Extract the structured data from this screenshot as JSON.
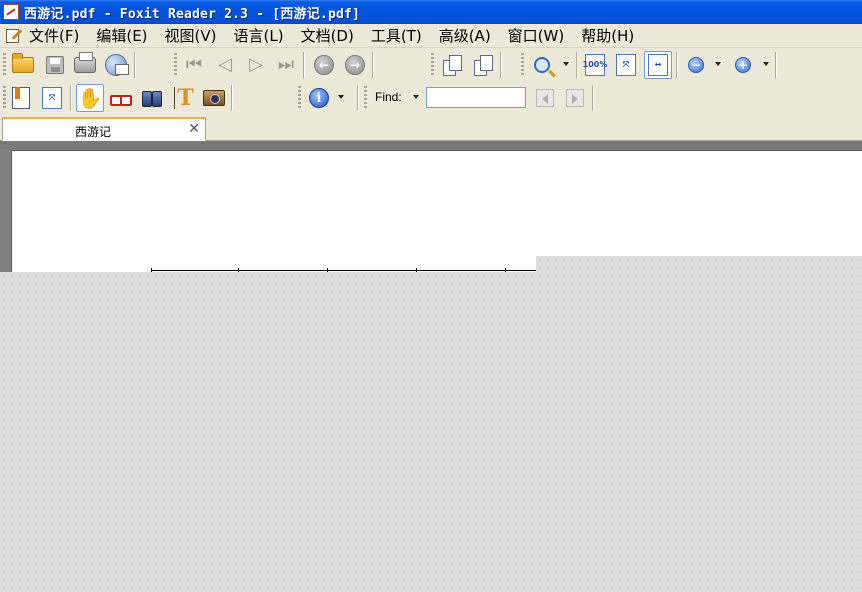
{
  "window": {
    "title": "西游记.pdf - Foxit Reader 2.3 - [西游记.pdf]"
  },
  "menubar": {
    "items": [
      "文件(F)",
      "编辑(E)",
      "视图(V)",
      "语言(L)",
      "文档(D)",
      "工具(T)",
      "高级(A)",
      "窗口(W)",
      "帮助(H)"
    ]
  },
  "toolbar1": {
    "icons": [
      "open-folder-icon",
      "save-icon",
      "print-icon",
      "email-icon",
      "first-page-icon",
      "previous-page-icon",
      "next-page-icon",
      "last-page-icon",
      "go-back-icon",
      "go-forward-icon",
      "rotate-left-icon",
      "rotate-right-icon",
      "zoom-in-tool-icon",
      "actual-size-icon",
      "fit-page-icon",
      "fit-width-icon",
      "zoom-out-icon",
      "zoom-in-icon"
    ],
    "actual_size_label": "100%"
  },
  "toolbar2": {
    "icons": [
      "bookmarks-icon",
      "thumbnails-icon",
      "hand-tool-icon",
      "loupe-icon",
      "find-binoculars-icon",
      "select-text-icon",
      "snapshot-icon",
      "info-icon"
    ],
    "find_label": "Find:",
    "find_value": ""
  },
  "tabs": [
    {
      "label": "西游记",
      "active": true
    }
  ],
  "colors": {
    "titlebar": "#0353dd",
    "chrome": "#ece9d8",
    "tab_accent": "#f0b030",
    "overlay": "#dcdcdc"
  }
}
